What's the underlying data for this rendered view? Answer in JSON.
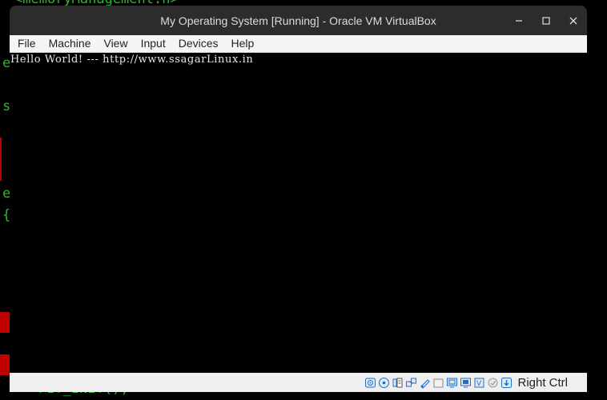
{
  "background_terminal": {
    "top_line": "<memoryManagement.h>",
    "frag_e1": "e",
    "frag_s": "s",
    "frag_e2": "e",
    "frag_brace": "{",
    "bottom_line": "PIT_INIT();"
  },
  "window": {
    "title": "My Operating System [Running] - Oracle VM VirtualBox",
    "controls": {
      "minimize": "–",
      "maximize": "□",
      "close": "✕"
    }
  },
  "menu": [
    "File",
    "Machine",
    "View",
    "Input",
    "Devices",
    "Help"
  ],
  "screen": {
    "console_text": "Hello World! --- http://www.ssagarLinux.in"
  },
  "statusbar": {
    "host_key": "Right Ctrl",
    "icons": [
      "hard-disk-icon",
      "optical-drive-icon",
      "audio-icon",
      "network-icon",
      "usb-icon",
      "shared-folders-icon",
      "display-icon",
      "video-capture-icon",
      "cpu-icon",
      "mouse-integration-icon",
      "keyboard-icon"
    ]
  },
  "colors": {
    "terminal_green": "#2fb52f",
    "terminal_red": "#c00000",
    "titlebar": "#2c2c2c",
    "menubar": "#f6f5f4",
    "statusbar": "#efefef",
    "icon_blue": "#1f6fc2"
  }
}
